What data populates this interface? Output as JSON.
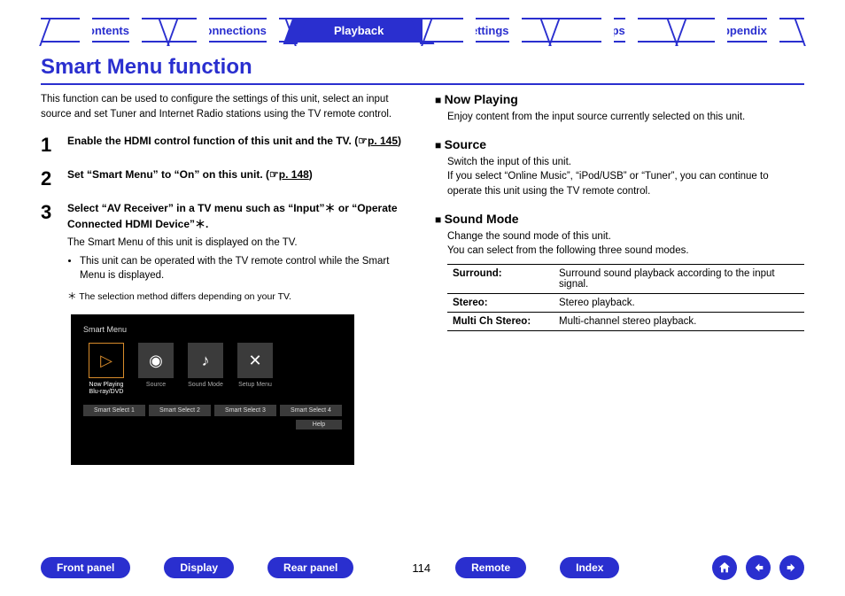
{
  "tabs": [
    "Contents",
    "Connections",
    "Playback",
    "Settings",
    "Tips",
    "Appendix"
  ],
  "active_tab_index": 2,
  "heading": "Smart Menu function",
  "intro": "This function can be used to configure the settings of this unit, select an input source and set Tuner and Internet Radio stations using the TV remote control.",
  "steps": {
    "s1": {
      "num": "1",
      "lead_a": "Enable the HDMI control function of this unit and the TV.  (",
      "link": "p. 145",
      "lead_b": ")"
    },
    "s2": {
      "num": "2",
      "lead_a": "Set “Smart Menu” to “On” on this unit.  (",
      "link": "p. 148",
      "lead_b": ")"
    },
    "s3": {
      "num": "3",
      "lead": "Select “AV Receiver” in a TV menu such as “Input”＊ or “Operate Connected HDMI Device”＊.",
      "sub": "The Smart Menu of this unit is displayed on the TV.",
      "bullet": "This unit can be operated with the TV remote control while the Smart Menu is displayed.",
      "note": "＊ The selection method differs depending on your TV."
    }
  },
  "tvshot": {
    "title": "Smart Menu",
    "tiles": [
      {
        "label_a": "Now Playing",
        "label_b": "Blu-ray/DVD",
        "icon": "▷",
        "sel": true
      },
      {
        "label_a": "Source",
        "label_b": "",
        "icon": "◉",
        "sel": false
      },
      {
        "label_a": "Sound Mode",
        "label_b": "",
        "icon": "♪",
        "sel": false
      },
      {
        "label_a": "Setup Menu",
        "label_b": "",
        "icon": "✕",
        "sel": false
      }
    ],
    "chips": [
      "Smart Select 1",
      "Smart Select 2",
      "Smart Select 3",
      "Smart Select 4"
    ],
    "help": "Help"
  },
  "right": {
    "now_playing": {
      "title": "Now Playing",
      "body": "Enjoy content from the input source currently selected on this unit."
    },
    "source": {
      "title": "Source",
      "body1": "Switch the input of this unit.",
      "body2": "If you select “Online Music”, “iPod/USB” or “Tuner”, you can continue to operate this unit using the TV remote control."
    },
    "sound_mode": {
      "title": "Sound Mode",
      "body1": "Change the sound mode of this unit.",
      "body2": "You can select from the following three sound modes.",
      "rows": [
        {
          "k": "Surround:",
          "v": "Surround sound playback according to the input signal."
        },
        {
          "k": "Stereo:",
          "v": "Stereo playback."
        },
        {
          "k": "Multi Ch Stereo:",
          "v": "Multi-channel stereo playback."
        }
      ]
    }
  },
  "bottom": {
    "pills": [
      "Front panel",
      "Display",
      "Rear panel"
    ],
    "page": "114",
    "pills2": [
      "Remote",
      "Index"
    ]
  },
  "pointer_glyph": "☞"
}
